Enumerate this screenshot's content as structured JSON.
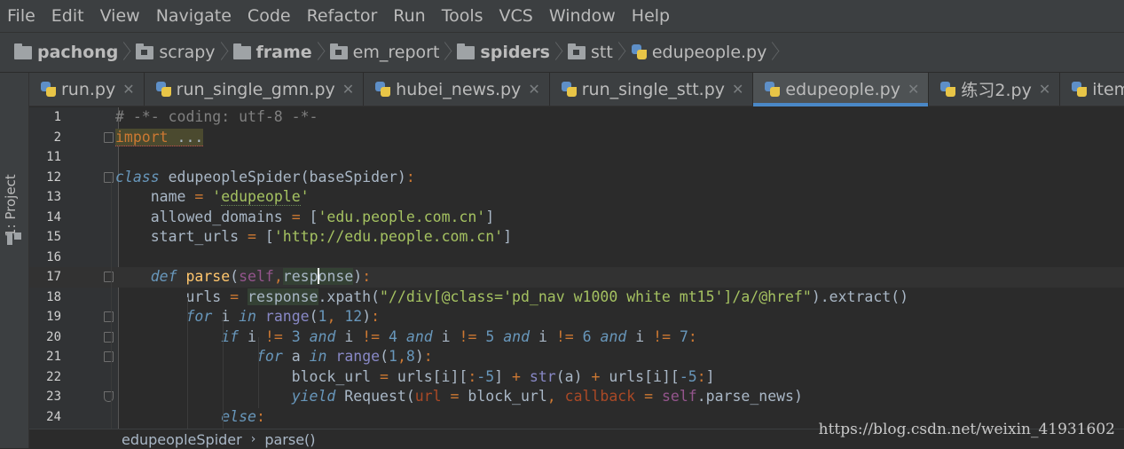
{
  "menu": [
    "File",
    "Edit",
    "View",
    "Navigate",
    "Code",
    "Refactor",
    "Run",
    "Tools",
    "VCS",
    "Window",
    "Help"
  ],
  "breadcrumbs": [
    {
      "label": "pachong",
      "bold": true,
      "icon": "folder-icon"
    },
    {
      "label": "scrapy",
      "bold": false,
      "icon": "package-folder-icon"
    },
    {
      "label": "frame",
      "bold": true,
      "icon": "folder-icon"
    },
    {
      "label": "em_report",
      "bold": false,
      "icon": "package-folder-icon"
    },
    {
      "label": "spiders",
      "bold": true,
      "icon": "folder-icon"
    },
    {
      "label": "stt",
      "bold": false,
      "icon": "package-folder-icon"
    },
    {
      "label": "edupeople.py",
      "bold": false,
      "icon": "python-file-icon"
    }
  ],
  "tool_window": {
    "label": "1: Project"
  },
  "tabs": [
    {
      "label": "run.py",
      "active": false
    },
    {
      "label": "run_single_gmn.py",
      "active": false
    },
    {
      "label": "hubei_news.py",
      "active": false
    },
    {
      "label": "run_single_stt.py",
      "active": false
    },
    {
      "label": "edupeople.py",
      "active": true
    },
    {
      "label": "练习2.py",
      "active": false
    },
    {
      "label": "items.py",
      "active": false
    }
  ],
  "editor": {
    "line_numbers": [
      "1",
      "2",
      "11",
      "12",
      "13",
      "14",
      "15",
      "16",
      "17",
      "18",
      "19",
      "20",
      "21",
      "22",
      "23",
      "24"
    ],
    "current_line": "17"
  },
  "status": {
    "class_crumb": "edupeopleSpider",
    "method_crumb": "parse()",
    "separator": "›"
  },
  "watermark": "https://blog.csdn.net/weixin_41931602"
}
